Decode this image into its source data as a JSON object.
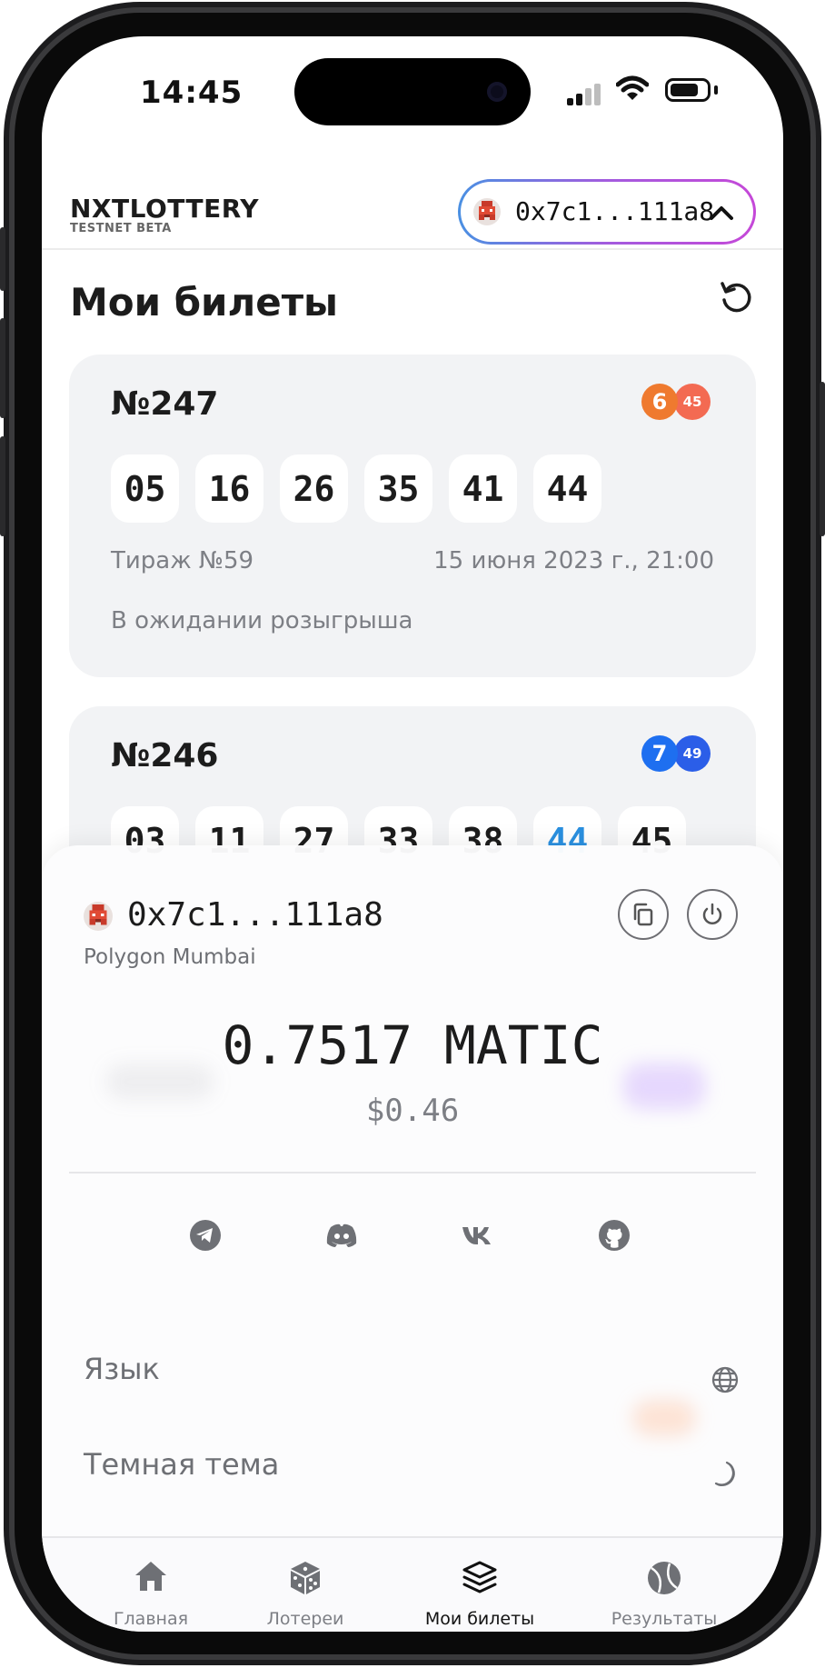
{
  "status_bar": {
    "time": "14:45"
  },
  "header": {
    "logo": "NXTLOTTERY",
    "logo_sub": "TESTNET BETA",
    "wallet_address": "0x7c1...111a8"
  },
  "page": {
    "title": "Мои билеты"
  },
  "tickets": [
    {
      "number": "№247",
      "ball_main": "6",
      "ball_extra": "45",
      "ball_colors": [
        "#ef7a2f",
        "#f06a4c"
      ],
      "numbers": [
        "05",
        "16",
        "26",
        "35",
        "41",
        "44"
      ],
      "draw": "Тираж №59",
      "date": "15 июня 2023 г., 21:00",
      "status": "В ожидании розыгрыша"
    },
    {
      "number": "№246",
      "ball_main": "7",
      "ball_extra": "49",
      "ball_colors": [
        "#1e6ff0",
        "#2b5ee8"
      ],
      "numbers": [
        "03",
        "11",
        "27",
        "33",
        "38",
        "44",
        "45"
      ],
      "highlighted_number": "44"
    }
  ],
  "wallet_sheet": {
    "address": "0x7c1...111a8",
    "network": "Polygon Mumbai",
    "balance": "0.7517 MATIC",
    "balance_usd": "$0.46",
    "socials": [
      "telegram-icon",
      "discord-icon",
      "vk-icon",
      "github-icon"
    ],
    "settings": [
      {
        "label": "Язык",
        "icon": "globe-icon"
      },
      {
        "label": "Темная тема",
        "icon": "moon-icon"
      }
    ]
  },
  "tabbar": {
    "items": [
      {
        "label": "Главная",
        "icon": "home-icon"
      },
      {
        "label": "Лотереи",
        "icon": "dice-icon"
      },
      {
        "label": "Мои билеты",
        "icon": "layers-icon",
        "active": true
      },
      {
        "label": "Результаты",
        "icon": "ball-icon"
      }
    ]
  },
  "colors": {
    "accent_gradient": [
      "#4a90e2",
      "#a35bde",
      "#c548d8"
    ],
    "highlight_number": "#2a90e0"
  }
}
